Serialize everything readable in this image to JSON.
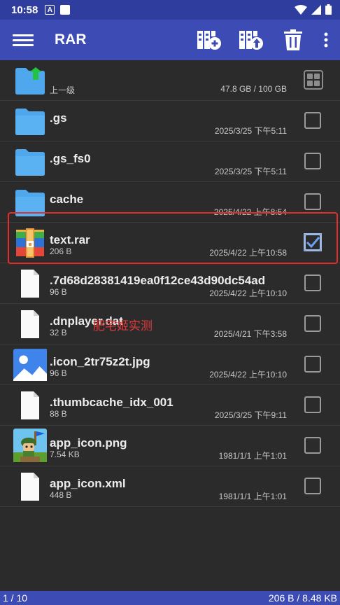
{
  "status_bar": {
    "time": "10:58",
    "notification_icon_letter": "A"
  },
  "app_bar": {
    "title": "RAR",
    "actions": [
      "add-to-archive-icon",
      "extract-icon",
      "delete-icon",
      "more-vert-icon"
    ]
  },
  "parent_row": {
    "label": "上一级",
    "storage": "47.8 GB / 100 GB"
  },
  "files": [
    {
      "name": ".gs",
      "meta": "",
      "date": "2025/3/25 下午5:11",
      "type": "folder",
      "checked": false
    },
    {
      "name": ".gs_fs0",
      "meta": "",
      "date": "2025/3/25 下午5:11",
      "type": "folder",
      "checked": false
    },
    {
      "name": "cache",
      "meta": "",
      "date": "2025/4/22 上午8:54",
      "type": "folder",
      "checked": false
    },
    {
      "name": "text.rar",
      "meta": "206 B",
      "date": "2025/4/22 上午10:58",
      "type": "rar",
      "checked": true
    },
    {
      "name": ".7d68d28381419ea0f12ce43d90dc54ad",
      "meta": "96 B",
      "date": "2025/4/22 上午10:10",
      "type": "file",
      "checked": false
    },
    {
      "name": ".dnplayer.dat",
      "meta": "32 B",
      "date": "2025/4/21 下午3:58",
      "type": "file",
      "checked": false
    },
    {
      "name": ".icon_2tr75z2t.jpg",
      "meta": "96 B",
      "date": "2025/4/22 上午10:10",
      "type": "image",
      "checked": false
    },
    {
      "name": ".thumbcache_idx_001",
      "meta": "88 B",
      "date": "2025/3/25 下午9:11",
      "type": "file",
      "checked": false
    },
    {
      "name": "app_icon.png",
      "meta": "7.54 KB",
      "date": "1981/1/1 上午1:01",
      "type": "app-image",
      "checked": false
    },
    {
      "name": "app_icon.xml",
      "meta": "448 B",
      "date": "1981/1/1 上午1:01",
      "type": "file",
      "checked": false
    }
  ],
  "watermark": "肥宅姬实测",
  "footer": {
    "selection": "1 / 10",
    "size": "206 B / 8.48 KB"
  },
  "colors": {
    "appbar": "#3d4bb4",
    "statusbar": "#2f3e9e",
    "folder": "#4fa8ee",
    "check": "#6aa0ee",
    "highlight": "#e52d2d"
  }
}
